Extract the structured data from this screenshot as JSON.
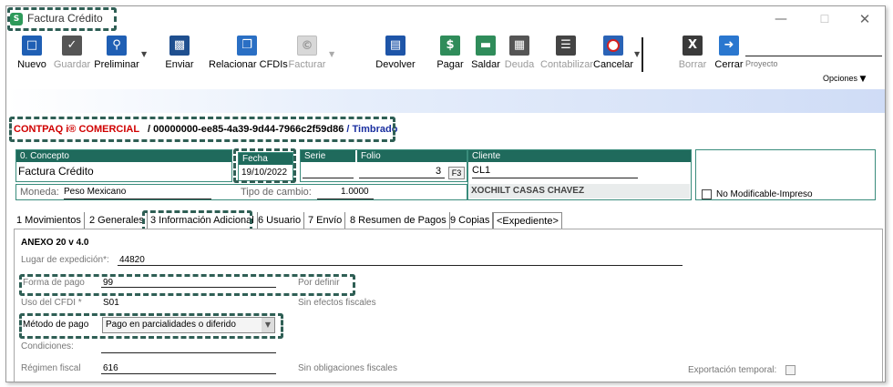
{
  "window": {
    "title": "Factura Crédito",
    "app_icon_letter": "S"
  },
  "toolbar": {
    "nuevo": "Nuevo",
    "guardar": "Guardar",
    "preliminar": "Preliminar",
    "enviar": "Enviar",
    "relacionar": "Relacionar CFDIs",
    "facturar": "Facturar",
    "devolver": "Devolver",
    "pagar": "Pagar",
    "saldar": "Saldar",
    "deuda": "Deuda",
    "contabilizar": "Contabilizar",
    "cancelar": "Cancelar",
    "borrar": "Borrar",
    "cerrar": "Cerrar",
    "proyecto": "Proyecto",
    "opciones": "Opciones"
  },
  "info": {
    "product": "CONTPAQ i® COMERCIAL",
    "uuid": "/ 00000000-ee85-4a39-9d44-7966c2f59d86",
    "status": "/ Timbrado"
  },
  "header": {
    "concepto_label": "0. Concepto",
    "concepto_value": "Factura Crédito",
    "fecha_label": "Fecha",
    "fecha_value": "19/10/2022",
    "serie_label": "Serie",
    "folio_label": "Folio",
    "folio_value": "3",
    "f3_label": "F3",
    "cliente_label": "Cliente",
    "cliente_code": "CL1",
    "cliente_name": "XOCHILT CASAS CHAVEZ",
    "moneda_label": "Moneda:",
    "moneda_value": "Peso Mexicano",
    "tipo_cambio_label": "Tipo de cambio:",
    "tipo_cambio_value": "1.0000",
    "no_modificable_label": "No Modificable-Impreso"
  },
  "tabs": [
    "1 Movimientos",
    "2 Generales",
    "3 Información Adicional",
    "6 Usuario",
    "7 Envío",
    "8 Resumen de Pagos",
    "9 Copias",
    "<Expediente>"
  ],
  "anexo": {
    "title": "ANEXO 20 v 4.0",
    "lugar_label": "Lugar de expedición*:",
    "lugar_value": "44820",
    "forma_label": "Forma de pago",
    "forma_value": "99",
    "forma_note": "Por definir",
    "uso_label": "Uso del CFDI *",
    "uso_value": "S01",
    "uso_note": "Sin efectos fiscales",
    "metodo_label": "Método de pago",
    "metodo_value": "Pago en parcialidades o diferido",
    "condiciones_label": "Condiciones:",
    "regimen_label": "Régimen fiscal",
    "regimen_value": "616",
    "regimen_note": "Sin obligaciones fiscales",
    "exportacion_label": "Exportación temporal:"
  }
}
